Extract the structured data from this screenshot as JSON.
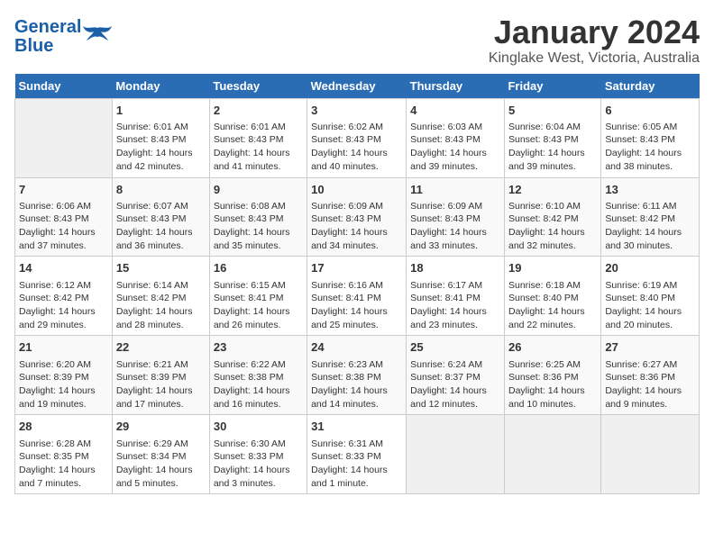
{
  "header": {
    "logo_line1": "General",
    "logo_line2": "Blue",
    "title": "January 2024",
    "subtitle": "Kinglake West, Victoria, Australia"
  },
  "columns": [
    "Sunday",
    "Monday",
    "Tuesday",
    "Wednesday",
    "Thursday",
    "Friday",
    "Saturday"
  ],
  "weeks": [
    [
      {
        "day": "",
        "info": ""
      },
      {
        "day": "1",
        "info": "Sunrise: 6:01 AM\nSunset: 8:43 PM\nDaylight: 14 hours\nand 42 minutes."
      },
      {
        "day": "2",
        "info": "Sunrise: 6:01 AM\nSunset: 8:43 PM\nDaylight: 14 hours\nand 41 minutes."
      },
      {
        "day": "3",
        "info": "Sunrise: 6:02 AM\nSunset: 8:43 PM\nDaylight: 14 hours\nand 40 minutes."
      },
      {
        "day": "4",
        "info": "Sunrise: 6:03 AM\nSunset: 8:43 PM\nDaylight: 14 hours\nand 39 minutes."
      },
      {
        "day": "5",
        "info": "Sunrise: 6:04 AM\nSunset: 8:43 PM\nDaylight: 14 hours\nand 39 minutes."
      },
      {
        "day": "6",
        "info": "Sunrise: 6:05 AM\nSunset: 8:43 PM\nDaylight: 14 hours\nand 38 minutes."
      }
    ],
    [
      {
        "day": "7",
        "info": "Sunrise: 6:06 AM\nSunset: 8:43 PM\nDaylight: 14 hours\nand 37 minutes."
      },
      {
        "day": "8",
        "info": "Sunrise: 6:07 AM\nSunset: 8:43 PM\nDaylight: 14 hours\nand 36 minutes."
      },
      {
        "day": "9",
        "info": "Sunrise: 6:08 AM\nSunset: 8:43 PM\nDaylight: 14 hours\nand 35 minutes."
      },
      {
        "day": "10",
        "info": "Sunrise: 6:09 AM\nSunset: 8:43 PM\nDaylight: 14 hours\nand 34 minutes."
      },
      {
        "day": "11",
        "info": "Sunrise: 6:09 AM\nSunset: 8:43 PM\nDaylight: 14 hours\nand 33 minutes."
      },
      {
        "day": "12",
        "info": "Sunrise: 6:10 AM\nSunset: 8:42 PM\nDaylight: 14 hours\nand 32 minutes."
      },
      {
        "day": "13",
        "info": "Sunrise: 6:11 AM\nSunset: 8:42 PM\nDaylight: 14 hours\nand 30 minutes."
      }
    ],
    [
      {
        "day": "14",
        "info": "Sunrise: 6:12 AM\nSunset: 8:42 PM\nDaylight: 14 hours\nand 29 minutes."
      },
      {
        "day": "15",
        "info": "Sunrise: 6:14 AM\nSunset: 8:42 PM\nDaylight: 14 hours\nand 28 minutes."
      },
      {
        "day": "16",
        "info": "Sunrise: 6:15 AM\nSunset: 8:41 PM\nDaylight: 14 hours\nand 26 minutes."
      },
      {
        "day": "17",
        "info": "Sunrise: 6:16 AM\nSunset: 8:41 PM\nDaylight: 14 hours\nand 25 minutes."
      },
      {
        "day": "18",
        "info": "Sunrise: 6:17 AM\nSunset: 8:41 PM\nDaylight: 14 hours\nand 23 minutes."
      },
      {
        "day": "19",
        "info": "Sunrise: 6:18 AM\nSunset: 8:40 PM\nDaylight: 14 hours\nand 22 minutes."
      },
      {
        "day": "20",
        "info": "Sunrise: 6:19 AM\nSunset: 8:40 PM\nDaylight: 14 hours\nand 20 minutes."
      }
    ],
    [
      {
        "day": "21",
        "info": "Sunrise: 6:20 AM\nSunset: 8:39 PM\nDaylight: 14 hours\nand 19 minutes."
      },
      {
        "day": "22",
        "info": "Sunrise: 6:21 AM\nSunset: 8:39 PM\nDaylight: 14 hours\nand 17 minutes."
      },
      {
        "day": "23",
        "info": "Sunrise: 6:22 AM\nSunset: 8:38 PM\nDaylight: 14 hours\nand 16 minutes."
      },
      {
        "day": "24",
        "info": "Sunrise: 6:23 AM\nSunset: 8:38 PM\nDaylight: 14 hours\nand 14 minutes."
      },
      {
        "day": "25",
        "info": "Sunrise: 6:24 AM\nSunset: 8:37 PM\nDaylight: 14 hours\nand 12 minutes."
      },
      {
        "day": "26",
        "info": "Sunrise: 6:25 AM\nSunset: 8:36 PM\nDaylight: 14 hours\nand 10 minutes."
      },
      {
        "day": "27",
        "info": "Sunrise: 6:27 AM\nSunset: 8:36 PM\nDaylight: 14 hours\nand 9 minutes."
      }
    ],
    [
      {
        "day": "28",
        "info": "Sunrise: 6:28 AM\nSunset: 8:35 PM\nDaylight: 14 hours\nand 7 minutes."
      },
      {
        "day": "29",
        "info": "Sunrise: 6:29 AM\nSunset: 8:34 PM\nDaylight: 14 hours\nand 5 minutes."
      },
      {
        "day": "30",
        "info": "Sunrise: 6:30 AM\nSunset: 8:33 PM\nDaylight: 14 hours\nand 3 minutes."
      },
      {
        "day": "31",
        "info": "Sunrise: 6:31 AM\nSunset: 8:33 PM\nDaylight: 14 hours\nand 1 minute."
      },
      {
        "day": "",
        "info": ""
      },
      {
        "day": "",
        "info": ""
      },
      {
        "day": "",
        "info": ""
      }
    ]
  ]
}
